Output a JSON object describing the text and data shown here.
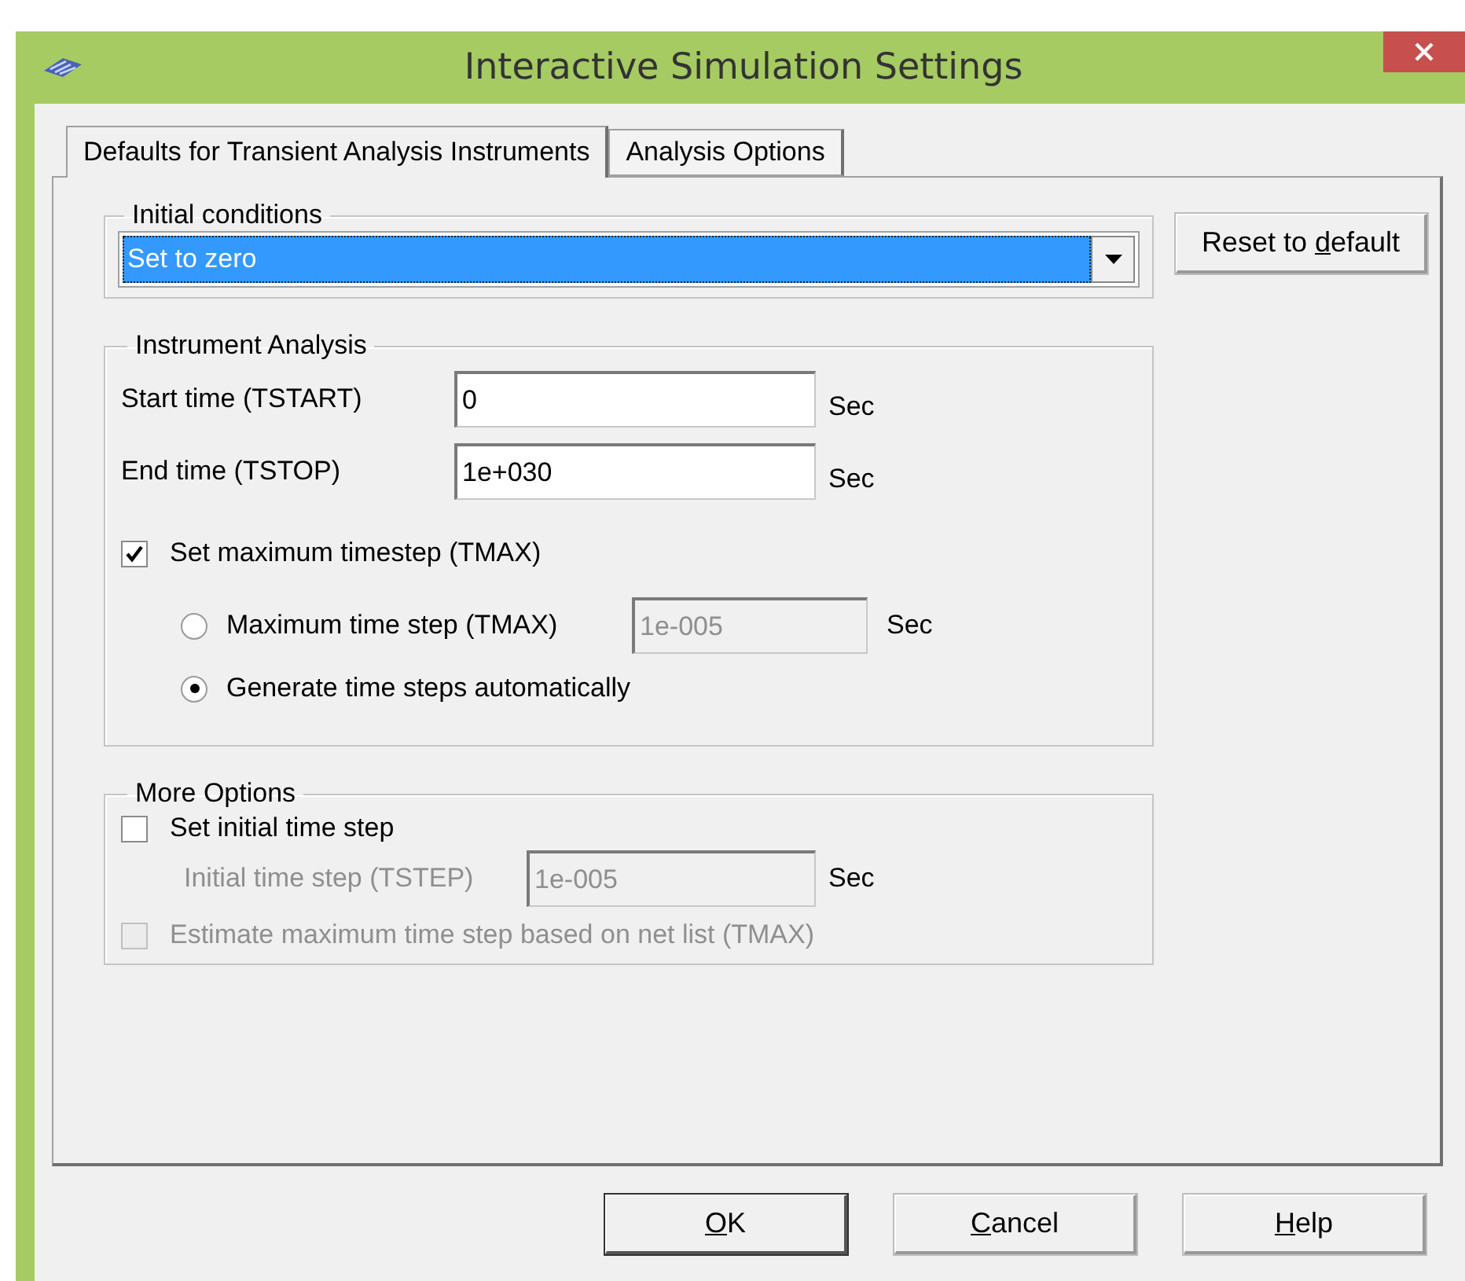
{
  "window": {
    "title": "Interactive Simulation Settings"
  },
  "tabs": [
    {
      "label": "Defaults for Transient Analysis Instruments",
      "selected": true
    },
    {
      "label": "Analysis Options",
      "selected": false
    }
  ],
  "initial_conditions": {
    "label": "Initial conditions",
    "value": "Set to zero"
  },
  "reset_button": {
    "pre": "Reset to ",
    "key": "d",
    "post": "efault"
  },
  "instrument_analysis": {
    "label": "Instrument Analysis",
    "fields": [
      {
        "label": "Start time (TSTART)",
        "value": "0",
        "unit": "Sec"
      },
      {
        "label": "End time (TSTOP)",
        "value": "1e+030",
        "unit": "Sec"
      }
    ],
    "max_timestep": {
      "label": "Set maximum timestep (TMAX)",
      "checked": true
    },
    "step_modes": [
      {
        "label": "Maximum time step (TMAX)",
        "selected": false,
        "value": "1e-005",
        "unit": "Sec",
        "disabled": true
      },
      {
        "label": "Generate time steps automatically",
        "selected": true
      }
    ]
  },
  "more_options": {
    "label": "More Options",
    "items": [
      {
        "kind": "checkbox",
        "label": "Set initial time step",
        "checked": false,
        "disabled": false
      },
      {
        "kind": "field",
        "label": "Initial time step (TSTEP)",
        "value": "1e-005",
        "unit": "Sec",
        "disabled": true
      },
      {
        "kind": "checkbox",
        "label": "Estimate maximum time step based on net list (TMAX)",
        "checked": false,
        "disabled": true
      }
    ]
  },
  "buttons": [
    {
      "key": "O",
      "post": "K",
      "default": true
    },
    {
      "key": "C",
      "post": "ancel",
      "default": false
    },
    {
      "key": "H",
      "post": "elp",
      "default": false
    }
  ]
}
